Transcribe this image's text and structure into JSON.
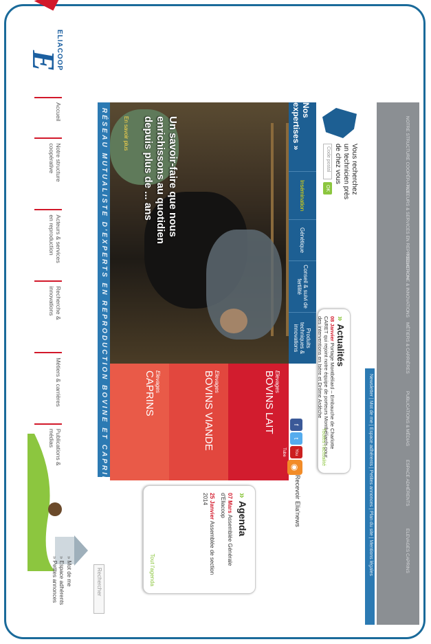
{
  "logo": {
    "text": "ELIACOOP"
  },
  "nav": [
    {
      "label": "Accueil"
    },
    {
      "label": "Notre structure coopérative"
    },
    {
      "label": "Acteurs & services en reproduction"
    },
    {
      "label": "Recherche & innovations"
    },
    {
      "label": "Métiers & carrières"
    },
    {
      "label": "Publications & médias"
    }
  ],
  "quick_links": [
    "Mot de me",
    "Espace adhérents",
    "Petites annonces"
  ],
  "search": {
    "placeholder": "Rechercher"
  },
  "banner": "RÉSEAU MUTUALISTE D'EXPERTS EN REPRODUCTION BOVINE ET CAPRINE",
  "hero": {
    "headline": "Un savoir-faire que nous enrichissons au quotidien depuis plus de ... ans",
    "more": "En savoir plus"
  },
  "cards": [
    {
      "label": "Elevages",
      "title": "BOVINS LAIT",
      "color": "#d21c2e"
    },
    {
      "label": "Elevages",
      "title": "BOVINS VIANDE",
      "color": "#e2473e"
    },
    {
      "label": "Elevages",
      "title": "CAPRINS",
      "color": "#e95a48"
    }
  ],
  "agenda": {
    "title": "Agenda",
    "items": [
      {
        "date": "07 Mars",
        "text": "Assemblée Générale d'Eliacoop"
      },
      {
        "date": "25 Janvier",
        "text": "Assemblée de section 2014"
      }
    ],
    "all": "Tout l'agenda"
  },
  "expertises": {
    "title": "Nos expertises",
    "tabs": [
      "Insémination",
      "Génétique",
      "Conseil & suivi de fertilité",
      "Produits techniques & innovations"
    ]
  },
  "social": {
    "newsletter": "Recevoir Elia'news",
    "fb": "f",
    "tw": "t",
    "yt": "You Tube",
    "rss": "RSS"
  },
  "actualites": {
    "title": "Actualités",
    "date": "08 Janvier",
    "text": "Portage Montbéliard – Embauche de Charlotte CARET qui rejoint notre équipe de porteurs Montbéliards pour des interventions en Isère et Drôme Ardèche",
    "all": "Toutes l'actualité"
  },
  "technicien": {
    "text": "Vous recherchez un technicien près de chez vous",
    "placeholder": "Code postal",
    "ok": "OK"
  },
  "footer_links": "Newsletter | Mot de me | Espace adhérents | Petites annonces | Plan du site | Mentions légales",
  "footer_cols": [
    "NOTRE STRUCTURE COOPÉRATIVE",
    "ACTEURS & SERVICES EN REPRODUCTION",
    "RECHERCHE & INNOVATIONS",
    "MÉTIERS & CARRIÈRES",
    "PUBLICATIONS & MÉDIAS",
    "ESPACE ADHÉRENTS",
    "ELEVAGES CAPRINS"
  ]
}
